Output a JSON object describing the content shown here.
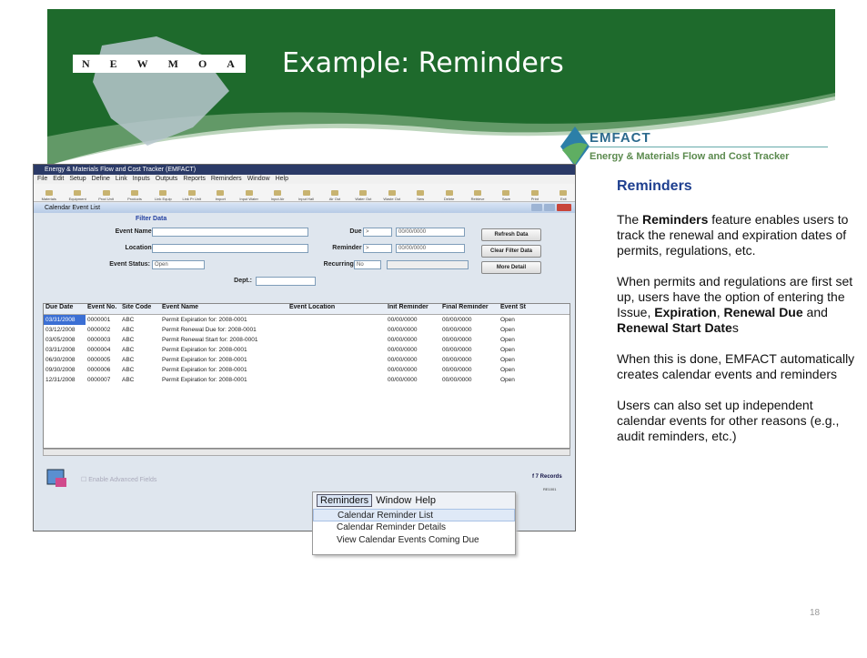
{
  "slide": {
    "title": "Example: Reminders",
    "newmoa_letters": [
      "N",
      "E",
      "W",
      "M",
      "O",
      "A"
    ],
    "emfact_name": "EMFACT",
    "emfact_tagline": "Energy & Materials Flow and Cost Tracker",
    "page_number": "18",
    "colors": {
      "banner_green": "#1e6a2c",
      "heading_blue": "#1e3f8f",
      "emfact_blue": "#2c6a8d"
    }
  },
  "app": {
    "window_title": "Energy & Materials Flow and Cost Tracker (EMFACT)",
    "menu": [
      "File",
      "Edit",
      "Setup",
      "Define",
      "Link",
      "Inputs",
      "Outputs",
      "Reports",
      "Reminders",
      "Window",
      "Help"
    ],
    "toolbar": [
      "Materials",
      "Equipment",
      "Prod Unit",
      "Products",
      "Link Equip",
      "Link Pr Unit",
      "Import",
      "Input Water",
      "Input Air",
      "Input Hall",
      "Air Out",
      "Water Out",
      "Waste Out",
      "New",
      "Delete",
      "Retrieve",
      "Save",
      "Print",
      "Exit"
    ],
    "inner_title": "Calendar Event List",
    "filter": {
      "heading": "Filter Data",
      "event_name_label": "Event Name:",
      "location_label": "Location:",
      "event_status_label": "Event Status:",
      "event_status_value": "Open",
      "dept_label": "Dept.:",
      "due_date_label": "Due Date:",
      "due_date_op": ">",
      "due_date_value": "00/00/0000",
      "reminder_date_label": "Reminder Date:",
      "reminder_date_op": ">",
      "reminder_date_value": "00/00/0000",
      "recurring_label": "Recurring?",
      "recurring_value": "No"
    },
    "buttons": {
      "refresh": "Refresh Data",
      "clear": "Clear Filter Data",
      "more": "More Detail"
    },
    "grid": {
      "headers": [
        "Due Date",
        "Event No.",
        "Site Code",
        "Event Name",
        "Event Location",
        "Init Reminder",
        "Final Reminder",
        "Event St"
      ],
      "rows": [
        [
          "03/31/2008",
          "0000001",
          "ABC",
          "Permit Expiration for: 2008-0001",
          "",
          "00/00/0000",
          "00/00/0000",
          "Open"
        ],
        [
          "03/12/2008",
          "0000002",
          "ABC",
          "Permit Renewal Due for: 2008-0001",
          "",
          "00/00/0000",
          "00/00/0000",
          "Open"
        ],
        [
          "03/05/2008",
          "0000003",
          "ABC",
          "Permit Renewal Start for: 2008-0001",
          "",
          "00/00/0000",
          "00/00/0000",
          "Open"
        ],
        [
          "03/31/2008",
          "0000004",
          "ABC",
          "Permit Expiration for: 2008-0001",
          "",
          "00/00/0000",
          "00/00/0000",
          "Open"
        ],
        [
          "06/30/2008",
          "0000005",
          "ABC",
          "Permit Expiration for: 2008-0001",
          "",
          "00/00/0000",
          "00/00/0000",
          "Open"
        ],
        [
          "09/30/2008",
          "0000006",
          "ABC",
          "Permit Expiration for: 2008-0001",
          "",
          "00/00/0000",
          "00/00/0000",
          "Open"
        ],
        [
          "12/31/2008",
          "0000007",
          "ABC",
          "Permit Expiration for: 2008-0001",
          "",
          "00/00/0000",
          "00/00/0000",
          "Open"
        ]
      ]
    },
    "advanced_label": "Enable Advanced Fields",
    "records": "f 7 Records",
    "version": "RE1001"
  },
  "popup": {
    "menubar": [
      "Reminders",
      "Window",
      "Help"
    ],
    "items": [
      "Calendar Reminder List",
      "Calendar Reminder Details",
      "View Calendar Events Coming Due"
    ]
  },
  "side": {
    "heading": "Reminders",
    "p1_pre": "The ",
    "p1_bold": "Reminders",
    "p1_post": " feature enables users to track the renewal and expiration dates of permits, regulations, etc.",
    "p2_pre": "When permits and regulations are first set up, users have the option of entering the Issue, ",
    "p2_b1": "Expiration",
    "p2_mid": ", ",
    "p2_b2": "Renewal Due",
    "p2_and": " and ",
    "p2_b3": "Renewal Start Date",
    "p2_post": "s",
    "p3": "When this is done, EMFACT automatically creates calendar events and reminders",
    "p4": "Users can also set up independent calendar events for other reasons (e.g., audit reminders, etc.)"
  }
}
